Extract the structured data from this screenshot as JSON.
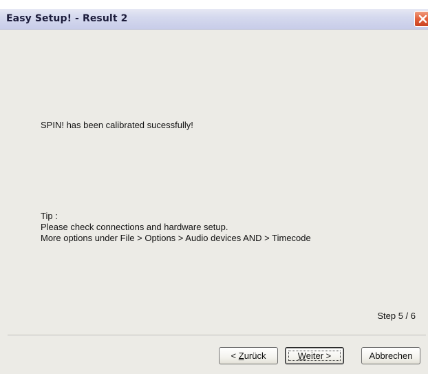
{
  "window": {
    "title": "Easy Setup! - Result 2"
  },
  "icons": {
    "close": "close-icon"
  },
  "content": {
    "status_message": "SPIN! has been calibrated sucessfully!",
    "tip_label": "Tip :",
    "tip_line1": "Please check connections and hardware setup.",
    "tip_line2": "More options under File > Options > Audio devices AND > Timecode",
    "step_text": "Step 5 / 6"
  },
  "buttons": {
    "back_prefix": "< ",
    "back_access": "Z",
    "back_rest": "urück",
    "next_access": "W",
    "next_rest": "eiter >",
    "cancel": "Abbrechen"
  },
  "colors": {
    "close_button": "#e2613c",
    "dialog_background": "#ecebe6"
  }
}
